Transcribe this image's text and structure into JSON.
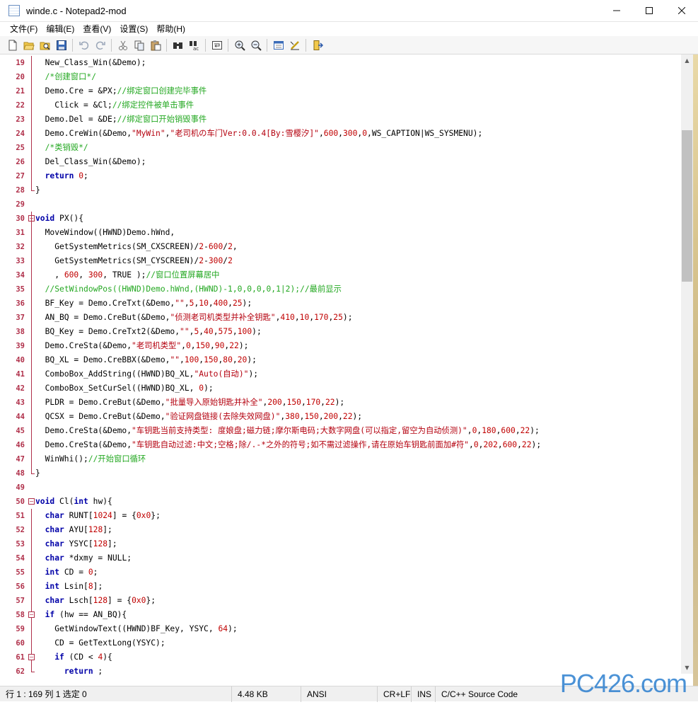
{
  "window": {
    "title": "winde.c - Notepad2-mod",
    "minimize": "—",
    "maximize": "☐",
    "close": "✕"
  },
  "menu": [
    "文件(F)",
    "编辑(E)",
    "查看(V)",
    "设置(S)",
    "帮助(H)"
  ],
  "toolbar_icons": [
    "new-file-icon",
    "open-icon",
    "browse-icon",
    "save-icon",
    "|",
    "undo-icon",
    "redo-icon",
    "|",
    "cut-icon",
    "copy-icon",
    "paste-icon",
    "|",
    "find-icon",
    "replace-icon",
    "|",
    "word-wrap-icon",
    "|",
    "zoom-in-icon",
    "zoom-out-icon",
    "|",
    "schemes-icon",
    "customize-icon",
    "|",
    "exit-icon"
  ],
  "code_lines": [
    {
      "n": "19",
      "html": "  New_Class_Win(&amp;Demo);"
    },
    {
      "n": "20",
      "html": "  <span class='cm'>/*创建窗口*/</span>"
    },
    {
      "n": "21",
      "html": "  Demo.Cre = &amp;PX;<span class='cm'>//绑定窗口创建完毕事件</span>"
    },
    {
      "n": "22",
      "html": "    Click = &amp;Cl;<span class='cm'>//绑定控件被单击事件</span>"
    },
    {
      "n": "23",
      "html": "  Demo.Del = &amp;DE;<span class='cm'>//绑定窗口开始销毁事件</span>"
    },
    {
      "n": "24",
      "html": "  Demo.CreWin(&amp;Demo,<span class='st'>\"MyWin\"</span>,<span class='st'>\"老司机の车门Ver:0.0.4[By:雪樱汐]\"</span>,<span class='nm'>600</span>,<span class='nm'>300</span>,<span class='nm'>0</span>,WS_CAPTION|WS_SYSMENU);"
    },
    {
      "n": "25",
      "html": "  <span class='cm'>/*类销毁*/</span>"
    },
    {
      "n": "26",
      "html": "  Del_Class_Win(&amp;Demo);"
    },
    {
      "n": "27",
      "html": "  <span class='kw'>return</span> <span class='nm'>0</span>;"
    },
    {
      "n": "28",
      "html": "}"
    },
    {
      "n": "29",
      "html": ""
    },
    {
      "n": "30",
      "html": "<span class='kw'>void</span> PX(){"
    },
    {
      "n": "31",
      "html": "  MoveWindow((HWND)Demo.hWnd,"
    },
    {
      "n": "32",
      "html": "    GetSystemMetrics(SM_CXSCREEN)/<span class='nm'>2</span>-<span class='nm'>600</span>/<span class='nm'>2</span>,"
    },
    {
      "n": "33",
      "html": "    GetSystemMetrics(SM_CYSCREEN)/<span class='nm'>2</span>-<span class='nm'>300</span>/<span class='nm'>2</span>"
    },
    {
      "n": "34",
      "html": "    , <span class='nm'>600</span>, <span class='nm'>300</span>, TRUE );<span class='cm'>//窗口位置屏幕居中</span>"
    },
    {
      "n": "35",
      "html": "  <span class='cm'>//SetWindowPos((HWND)Demo.hWnd,(HWND)-1,0,0,0,0,1|2);//最前显示</span>"
    },
    {
      "n": "36",
      "html": "  BF_Key = Demo.CreTxt(&amp;Demo,<span class='st'>\"\"</span>,<span class='nm'>5</span>,<span class='nm'>10</span>,<span class='nm'>400</span>,<span class='nm'>25</span>);"
    },
    {
      "n": "37",
      "html": "  AN_BQ = Demo.CreBut(&amp;Demo,<span class='st'>\"侦测老司机类型并补全钥匙\"</span>,<span class='nm'>410</span>,<span class='nm'>10</span>,<span class='nm'>170</span>,<span class='nm'>25</span>);"
    },
    {
      "n": "38",
      "html": "  BQ_Key = Demo.CreTxt2(&amp;Demo,<span class='st'>\"\"</span>,<span class='nm'>5</span>,<span class='nm'>40</span>,<span class='nm'>575</span>,<span class='nm'>100</span>);"
    },
    {
      "n": "39",
      "html": "  Demo.CreSta(&amp;Demo,<span class='st'>\"老司机类型\"</span>,<span class='nm'>0</span>,<span class='nm'>150</span>,<span class='nm'>90</span>,<span class='nm'>22</span>);"
    },
    {
      "n": "40",
      "html": "  BQ_XL = Demo.CreBBX(&amp;Demo,<span class='st'>\"\"</span>,<span class='nm'>100</span>,<span class='nm'>150</span>,<span class='nm'>80</span>,<span class='nm'>20</span>);"
    },
    {
      "n": "41",
      "html": "  ComboBox_AddString((HWND)BQ_XL,<span class='st'>\"Auto(自动)\"</span>);"
    },
    {
      "n": "42",
      "html": "  ComboBox_SetCurSel((HWND)BQ_XL, <span class='nm'>0</span>);"
    },
    {
      "n": "43",
      "html": "  PLDR = Demo.CreBut(&amp;Demo,<span class='st'>\"批量导入原始钥匙并补全\"</span>,<span class='nm'>200</span>,<span class='nm'>150</span>,<span class='nm'>170</span>,<span class='nm'>22</span>);"
    },
    {
      "n": "44",
      "html": "  QCSX = Demo.CreBut(&amp;Demo,<span class='st'>\"验证网盘链接(去除失效网盘)\"</span>,<span class='nm'>380</span>,<span class='nm'>150</span>,<span class='nm'>200</span>,<span class='nm'>22</span>);"
    },
    {
      "n": "45",
      "html": "  Demo.CreSta(&amp;Demo,<span class='st'>\"车钥匙当前支持类型: 度娘盘;磁力链;摩尔斯电码;大数字网盘(可以指定,留空为自动侦测)\"</span>,<span class='nm'>0</span>,<span class='nm'>180</span>,<span class='nm'>600</span>,<span class='nm'>22</span>);"
    },
    {
      "n": "46",
      "html": "  Demo.CreSta(&amp;Demo,<span class='st'>\"车钥匙自动过滤:中文;空格;除/.-*之外的符号;如不需过滤操作,请在原始车钥匙前面加#符\"</span>,<span class='nm'>0</span>,<span class='nm'>202</span>,<span class='nm'>600</span>,<span class='nm'>22</span>);"
    },
    {
      "n": "47",
      "html": "  WinWhi();<span class='cm'>//开始窗口循环</span>"
    },
    {
      "n": "48",
      "html": "}"
    },
    {
      "n": "49",
      "html": ""
    },
    {
      "n": "50",
      "html": "<span class='kw'>void</span> Cl(<span class='kw'>int</span> hw){"
    },
    {
      "n": "51",
      "html": "  <span class='kw'>char</span> RUNT[<span class='nm'>1024</span>] = {<span class='nm'>0x0</span>};"
    },
    {
      "n": "52",
      "html": "  <span class='kw'>char</span> AYU[<span class='nm'>128</span>];"
    },
    {
      "n": "53",
      "html": "  <span class='kw'>char</span> YSYC[<span class='nm'>128</span>];"
    },
    {
      "n": "54",
      "html": "  <span class='kw'>char</span> *dxmy = NULL;"
    },
    {
      "n": "55",
      "html": "  <span class='kw'>int</span> CD = <span class='nm'>0</span>;"
    },
    {
      "n": "56",
      "html": "  <span class='kw'>int</span> Lsin[<span class='nm'>8</span>];"
    },
    {
      "n": "57",
      "html": "  <span class='kw'>char</span> Lsch[<span class='nm'>128</span>] = {<span class='nm'>0x0</span>};"
    },
    {
      "n": "58",
      "html": "  <span class='kw'>if</span> (hw == AN_BQ){"
    },
    {
      "n": "59",
      "html": "    GetWindowText((HWND)BF_Key, YSYC, <span class='nm'>64</span>);"
    },
    {
      "n": "60",
      "html": "    CD = GetTextLong(YSYC);"
    },
    {
      "n": "61",
      "html": "    <span class='kw'>if</span> (CD &lt; <span class='nm'>4</span>){"
    },
    {
      "n": "62",
      "html": "      <span class='kw'>return</span> ;"
    }
  ],
  "status": {
    "position": "行 1 : 169   列 1   选定 0",
    "size": "4.48 KB",
    "encoding": "ANSI",
    "eol": "CR+LF",
    "ins": "INS",
    "lexer": "C/C++ Source Code"
  },
  "watermark": "PC426.com",
  "colors": {
    "keyword": "#0000a8",
    "comment": "#24a822",
    "string": "#b4000e",
    "line_number": "#b0304a"
  }
}
